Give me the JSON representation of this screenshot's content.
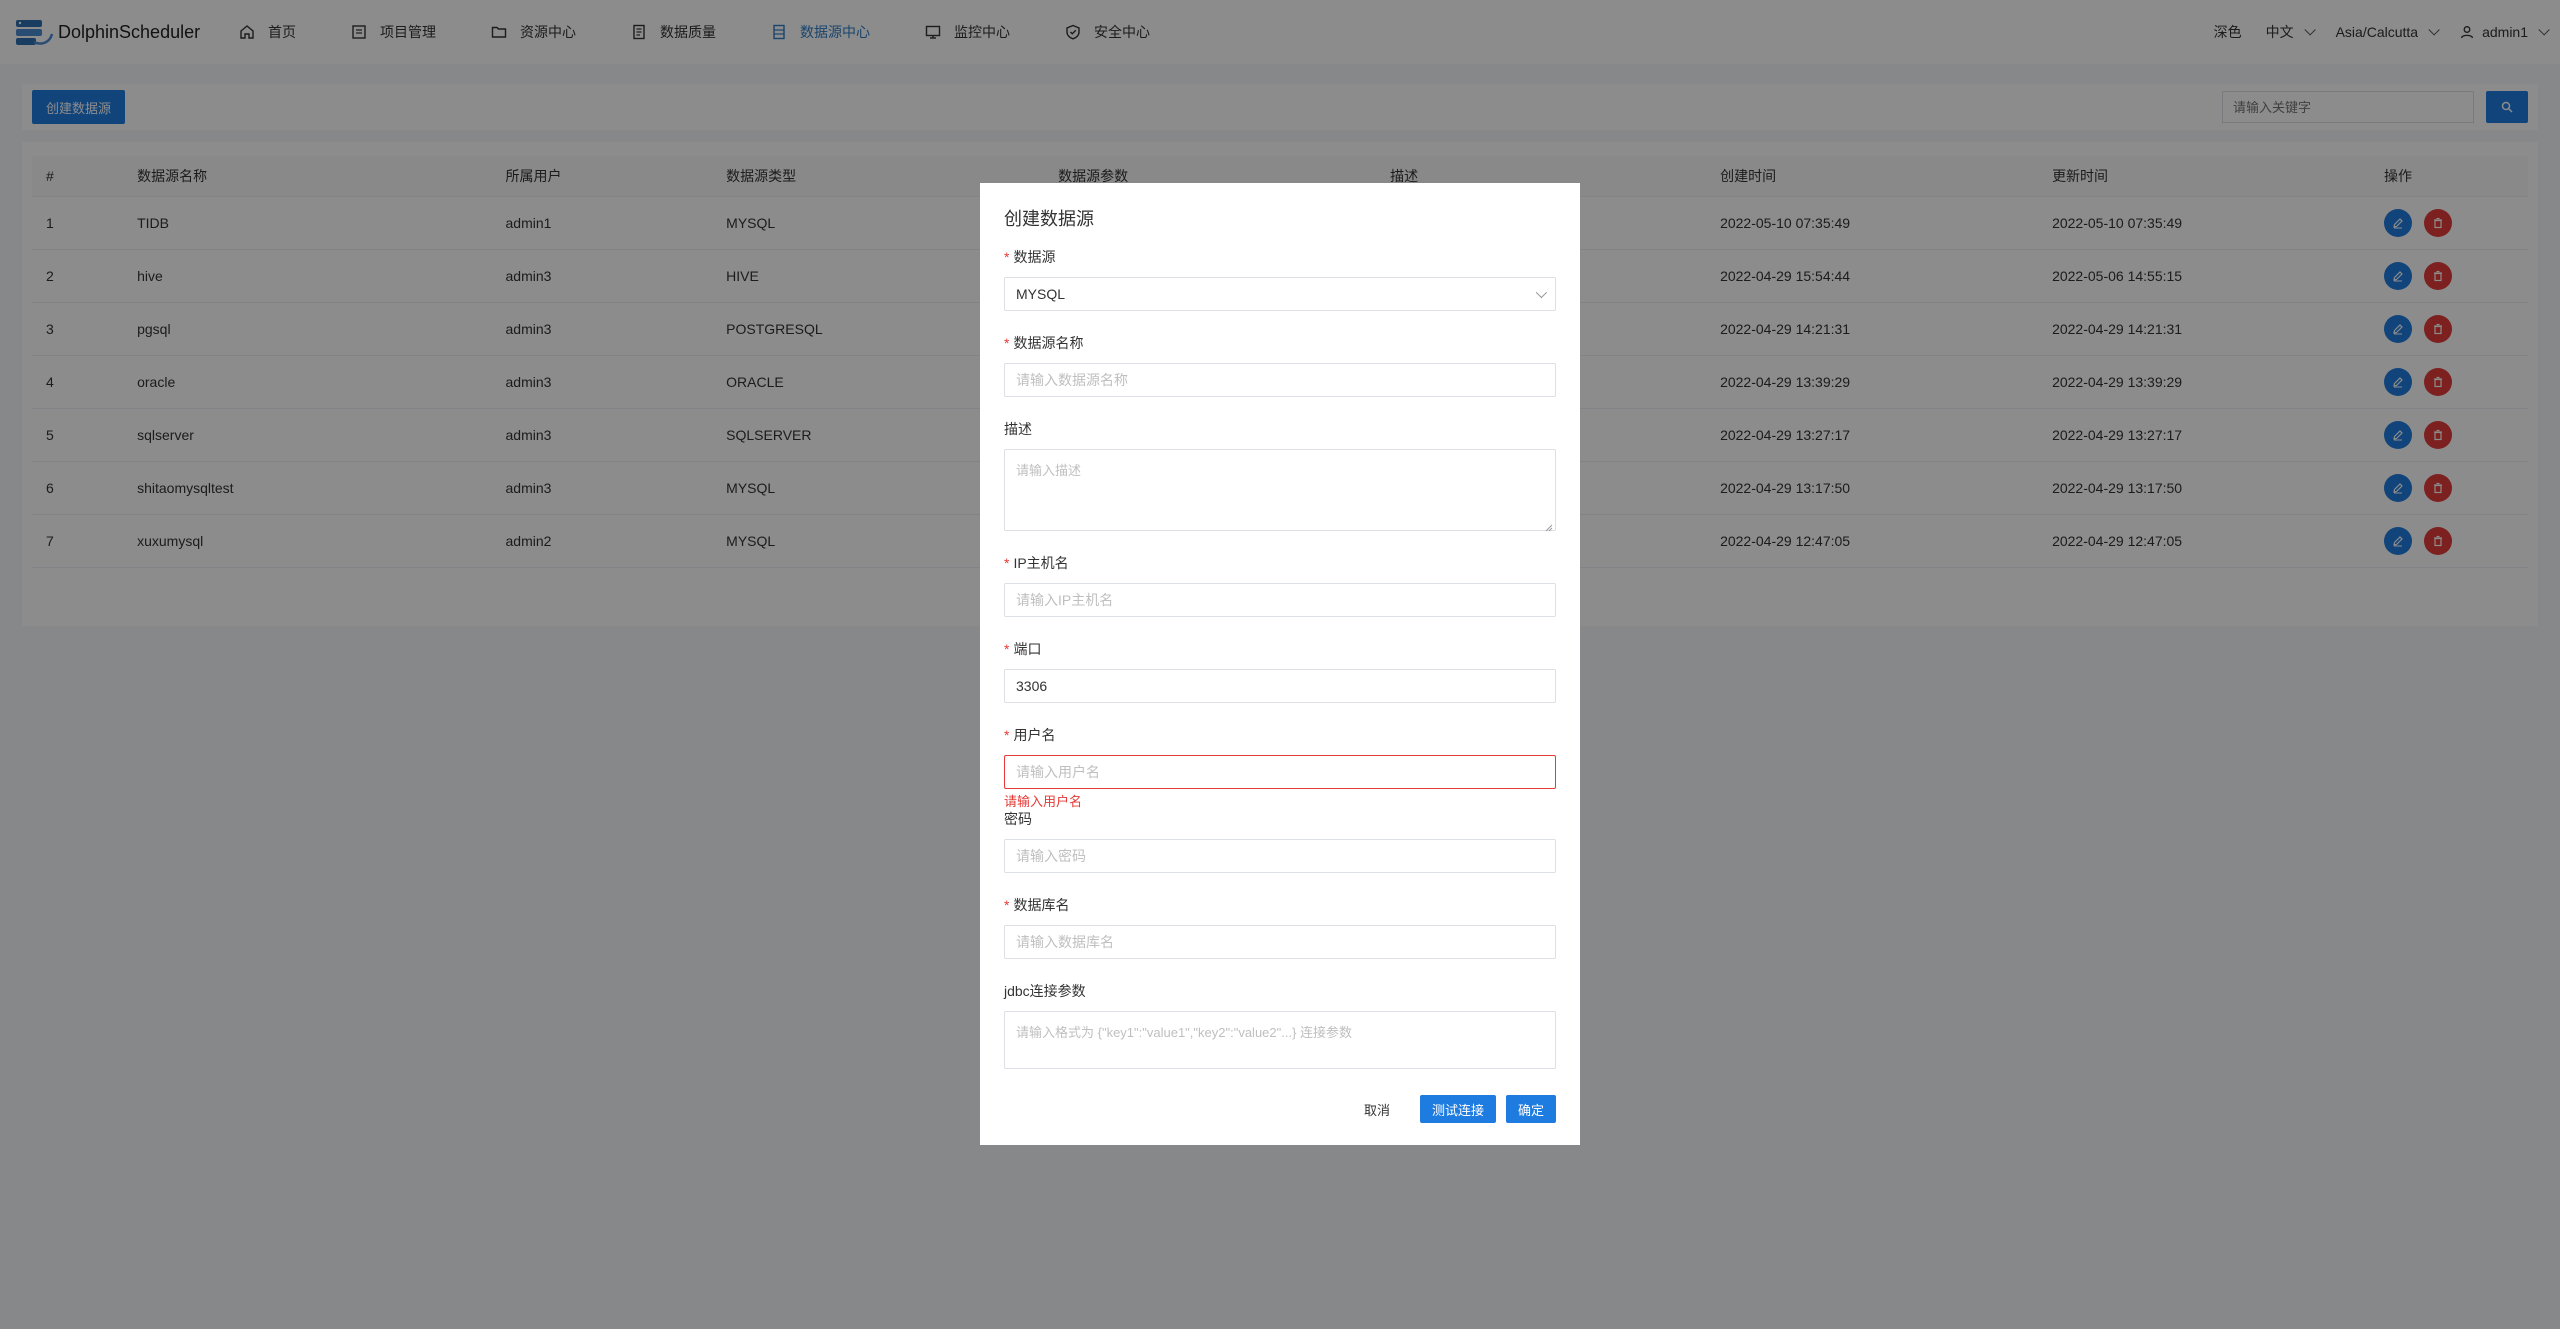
{
  "app": {
    "brand": "DolphinScheduler"
  },
  "nav": [
    {
      "label": "首页",
      "icon": "home-icon"
    },
    {
      "label": "项目管理",
      "icon": "project-icon"
    },
    {
      "label": "资源中心",
      "icon": "folder-icon"
    },
    {
      "label": "数据质量",
      "icon": "quality-icon"
    },
    {
      "label": "数据源中心",
      "icon": "datasource-icon",
      "active": true
    },
    {
      "label": "监控中心",
      "icon": "monitor-icon"
    },
    {
      "label": "安全中心",
      "icon": "shield-icon"
    }
  ],
  "topright": {
    "theme": "深色",
    "lang": "中文",
    "timezone": "Asia/Calcutta",
    "user": "admin1"
  },
  "toolbar": {
    "create_label": "创建数据源",
    "search_placeholder": "请输入关键字"
  },
  "table": {
    "headers": [
      "#",
      "数据源名称",
      "所属用户",
      "数据源类型",
      "数据源参数",
      "描述",
      "创建时间",
      "更新时间",
      "操作"
    ],
    "rows": [
      [
        "1",
        "TIDB",
        "admin1",
        "MYSQL",
        "",
        "",
        "2022-05-10 07:35:49",
        "2022-05-10 07:35:49"
      ],
      [
        "2",
        "hive",
        "admin3",
        "HIVE",
        "",
        "",
        "2022-04-29 15:54:44",
        "2022-05-06 14:55:15"
      ],
      [
        "3",
        "pgsql",
        "admin3",
        "POSTGRESQL",
        "",
        "",
        "2022-04-29 14:21:31",
        "2022-04-29 14:21:31"
      ],
      [
        "4",
        "oracle",
        "admin3",
        "ORACLE",
        "",
        "",
        "2022-04-29 13:39:29",
        "2022-04-29 13:39:29"
      ],
      [
        "5",
        "sqlserver",
        "admin3",
        "SQLSERVER",
        "",
        "",
        "2022-04-29 13:27:17",
        "2022-04-29 13:27:17"
      ],
      [
        "6",
        "shitaomysqltest",
        "admin3",
        "MYSQL",
        "",
        "",
        "2022-04-29 13:17:50",
        "2022-04-29 13:17:50"
      ],
      [
        "7",
        "xuxumysql",
        "admin2",
        "MYSQL",
        "",
        "",
        "2022-04-29 12:47:05",
        "2022-04-29 12:47:05"
      ]
    ]
  },
  "modal": {
    "title": "创建数据源",
    "datasource_label": "数据源",
    "datasource_value": "MYSQL",
    "name_label": "数据源名称",
    "name_placeholder": "请输入数据源名称",
    "desc_label": "描述",
    "desc_placeholder": "请输入描述",
    "host_label": "IP主机名",
    "host_placeholder": "请输入IP主机名",
    "port_label": "端口",
    "port_value": "3306",
    "user_label": "用户名",
    "user_placeholder": "请输入用户名",
    "user_error": "请输入用户名",
    "password_label": "密码",
    "password_placeholder": "请输入密码",
    "db_label": "数据库名",
    "db_placeholder": "请输入数据库名",
    "jdbc_label": "jdbc连接参数",
    "jdbc_placeholder": "请输入格式为 {\"key1\":\"value1\",\"key2\":\"value2\"...} 连接参数",
    "cancel": "取消",
    "test": "测试连接",
    "confirm": "确定"
  }
}
